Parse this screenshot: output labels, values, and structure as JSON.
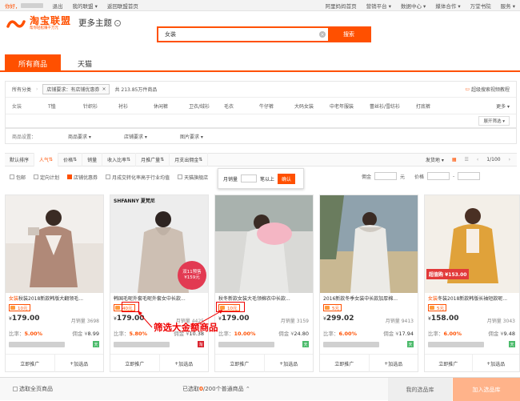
{
  "topbar": {
    "greeting": "你好，",
    "logout": "退出",
    "my_alliance": "我的联盟",
    "back_home": "返回联盟首页",
    "right_items": [
      "阿里妈妈首页",
      "营销平台",
      "数据中心",
      "媒体合作",
      "万堂书院",
      "服务"
    ]
  },
  "brand": {
    "name": "淘宝联盟",
    "slogan": "帮你轻松赚千万元",
    "theme": "更多主题"
  },
  "search": {
    "value": "女装",
    "button": "搜索"
  },
  "tabs": [
    {
      "label": "所有商品",
      "active": true
    },
    {
      "label": "天猫",
      "active": false
    }
  ],
  "filters": {
    "all_categories": "所有分类",
    "chip_text": "店铺要求：有店铺优惠券",
    "result_count": "共 213.85万件商品",
    "right_link": "超级搜索视频教程",
    "cat_label": "女装",
    "categories": [
      "T恤",
      "针织衫",
      "衬衫",
      "休闲裤",
      "卫衣/绒衫",
      "毛衣",
      "牛仔裤",
      "大码女装",
      "中老年服装",
      "蕾丝衫/雪纺衫",
      "打底裤"
    ],
    "more": "更多",
    "expand": "展开筛选",
    "goods_setting": "商品设置：",
    "dropdowns": [
      "商品要求",
      "店铺要求",
      "图片要求"
    ]
  },
  "sort": {
    "items": [
      "默认排序",
      "人气",
      "价格",
      "销量",
      "收入比率",
      "月推广量",
      "月支出佣金"
    ],
    "ship_from": "发货地",
    "page": "1/100"
  },
  "options": {
    "checkboxes": [
      {
        "label": "包邮",
        "checked": false
      },
      {
        "label": "定向计划",
        "checked": false
      },
      {
        "label": "店铺优惠券",
        "checked": true
      },
      {
        "label": "月成交转化率高于行业均值",
        "checked": false
      },
      {
        "label": "天猫旗舰店",
        "checked": false
      }
    ],
    "popover": {
      "label": "月销量",
      "suffix": "笔以上",
      "confirm": "确认"
    },
    "commission_label": "佣金",
    "price_label": "价格",
    "range_unit": "元",
    "range_sep": "-"
  },
  "products": [
    {
      "title_kw": "女装",
      "title": "秋装2018新款韩版大翻领毛...",
      "coupon": "10元",
      "price": "179.00",
      "sales_label": "月销量",
      "sales": "3698",
      "rate_label": "比率：",
      "rate": "5.00%",
      "comm_label": "佣金",
      "comm": "8.99",
      "mall": "tmall"
    },
    {
      "title_kw": "",
      "title": "韩国毛呢外套毛呢外套女中长款...",
      "brand_text": "SHFANNY 夏梵尼",
      "badge": "双11预售 ¥159元",
      "coupon": "40元",
      "price": "179.00",
      "sales_label": "月销量",
      "sales": "4425",
      "rate_label": "比率：",
      "rate": "5.80%",
      "comm_label": "佣金",
      "comm": "10.38",
      "mall": "taobao"
    },
    {
      "title_kw": "",
      "title": "秋冬新款女装大毛领棉衣中长款...",
      "coupon": "10元",
      "price": "179.00",
      "sales_label": "月销量",
      "sales": "3159",
      "rate_label": "比率：",
      "rate": "10.00%",
      "comm_label": "佣金",
      "comm": "24.80",
      "mall": "tmall"
    },
    {
      "title_kw": "女装",
      "title": "2016新款冬季女装中长款加厚棉...",
      "coupon": "5元",
      "price": "299.02",
      "sales_label": "月销量",
      "sales": "9413",
      "rate_label": "比率：",
      "rate": "6.00%",
      "comm_label": "佣金",
      "comm": "17.94",
      "mall": "tmall"
    },
    {
      "title_kw": "女装",
      "title": "冬装2018新款韩版长袖短款呢...",
      "badge": "超值购 ¥153.00",
      "coupon": "5元",
      "price": "158.00",
      "sales_label": "月销量",
      "sales": "3043",
      "rate_label": "比率：",
      "rate": "6.00%",
      "comm_label": "佣金",
      "comm": "9.48",
      "mall": "tmall"
    }
  ],
  "card_actions": {
    "promote": "立即推广",
    "add": "加选品"
  },
  "annotation": "筛选大金额商品",
  "footer": {
    "select_page": "选取全页商品",
    "selected_prefix": "已选取",
    "selected_count": "0",
    "selected_suffix": "/200个普通商品",
    "library": "我的选品库",
    "add_lib": "加入选品库"
  },
  "colors": {
    "accent": "#ff5000",
    "annotation": "#e00000",
    "tmall_tag": "#4aba6a",
    "taobao_tag": "#d9232e"
  }
}
